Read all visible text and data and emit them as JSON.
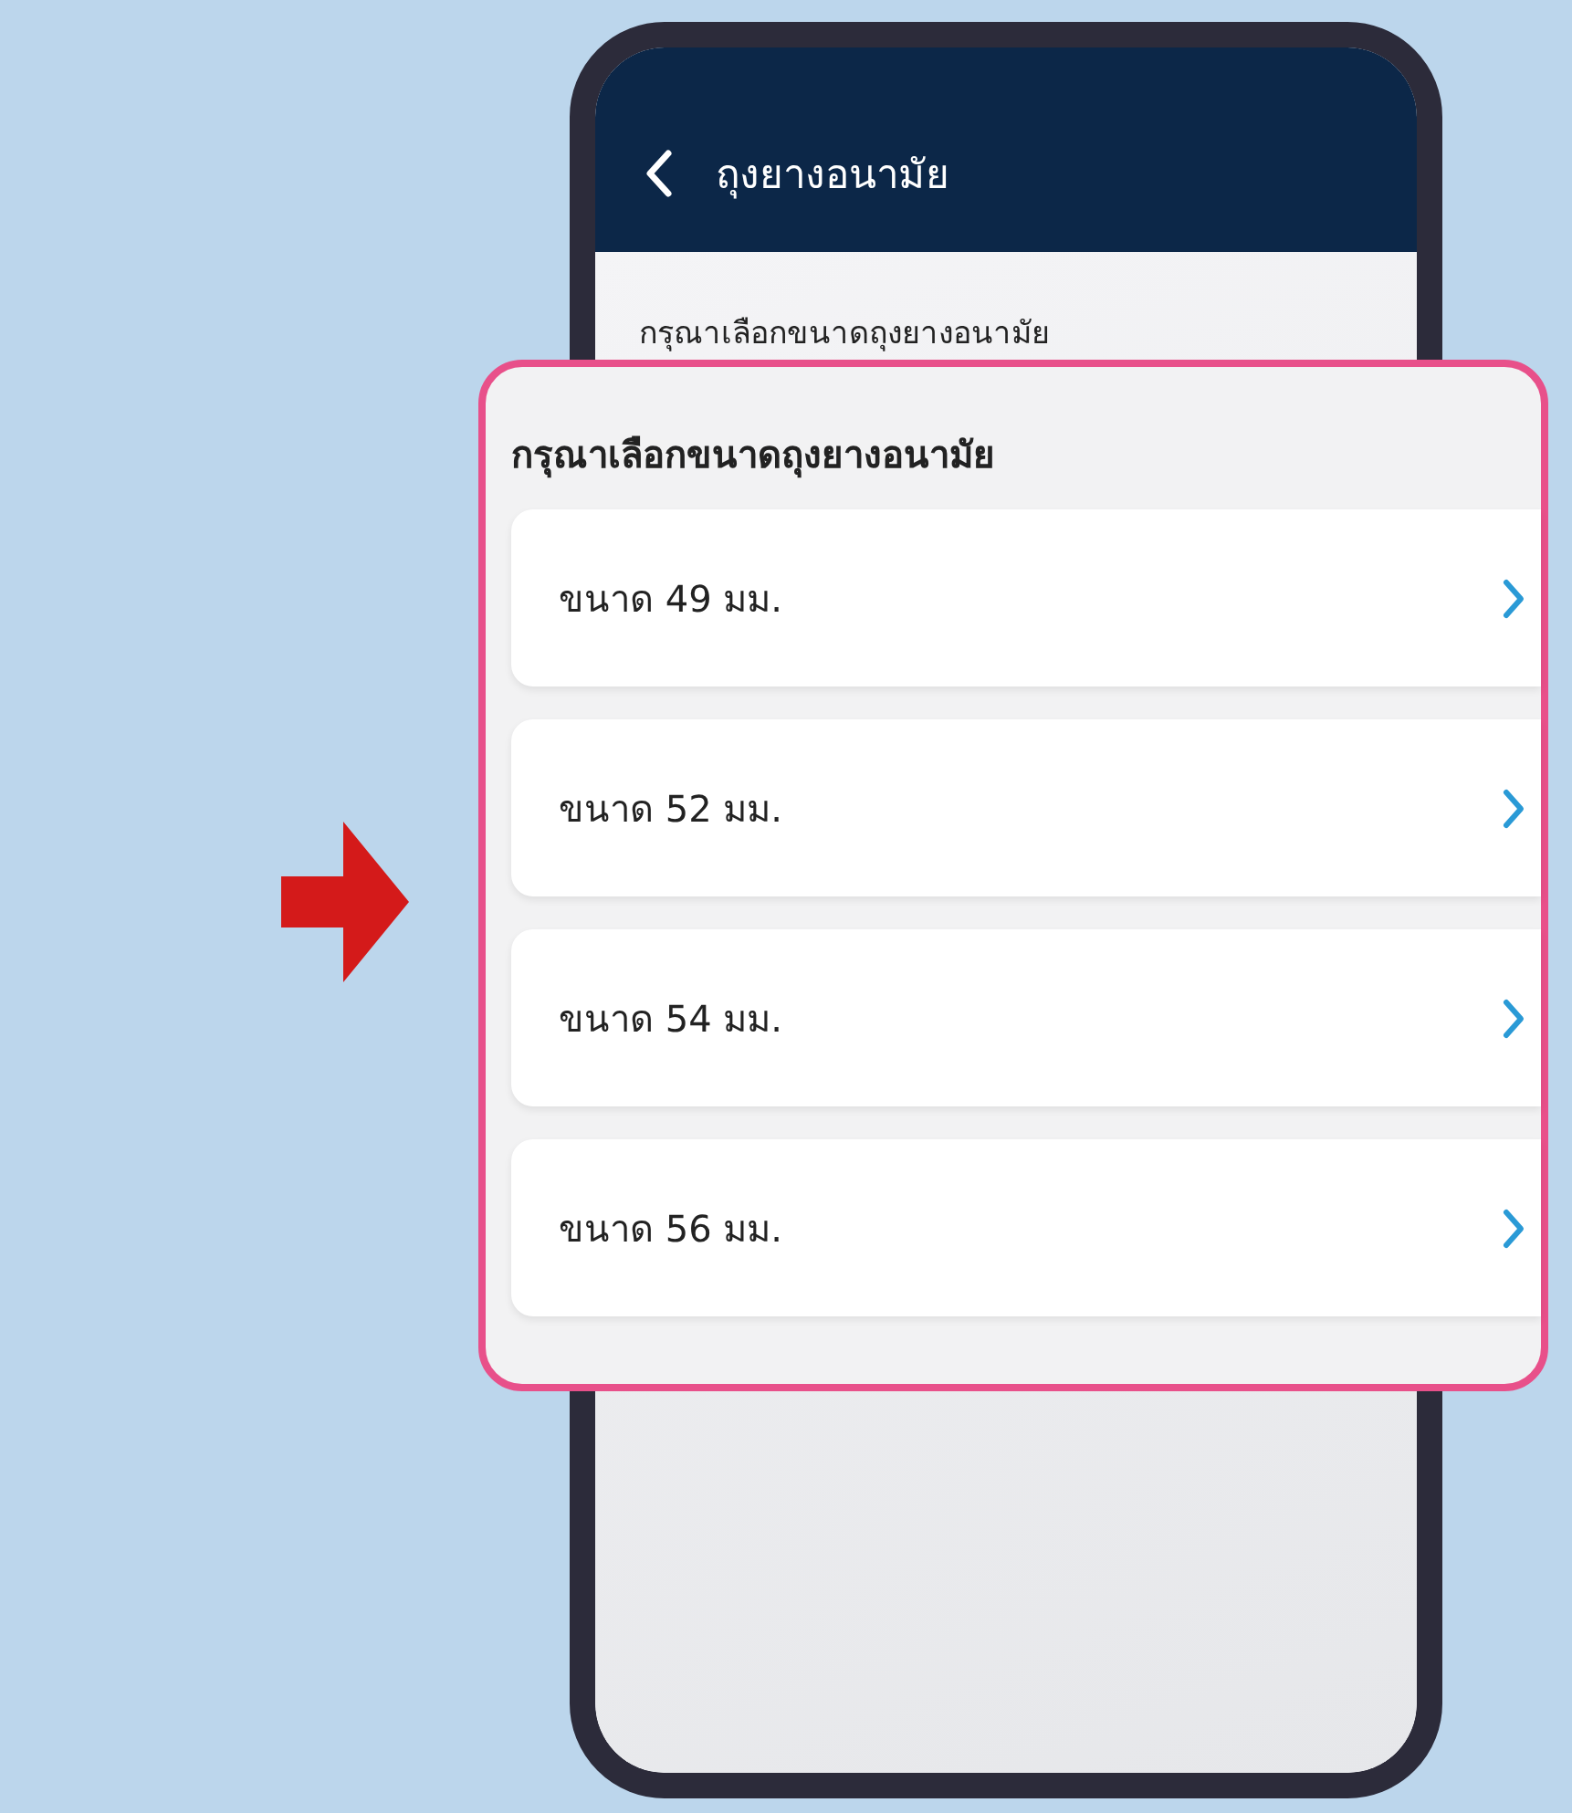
{
  "screen": {
    "title": "ถุงยางอนามัย",
    "prompt": "กรุณาเลือกขนาดถุงยางอนามัย"
  },
  "callout": {
    "title": "กรุณาเลือกขนาดถุงยางอนามัย",
    "items": [
      {
        "label": "ขนาด 49 มม."
      },
      {
        "label": "ขนาด 52 มม."
      },
      {
        "label": "ขนาด 54 มม."
      },
      {
        "label": "ขนาด 56 มม."
      }
    ]
  }
}
